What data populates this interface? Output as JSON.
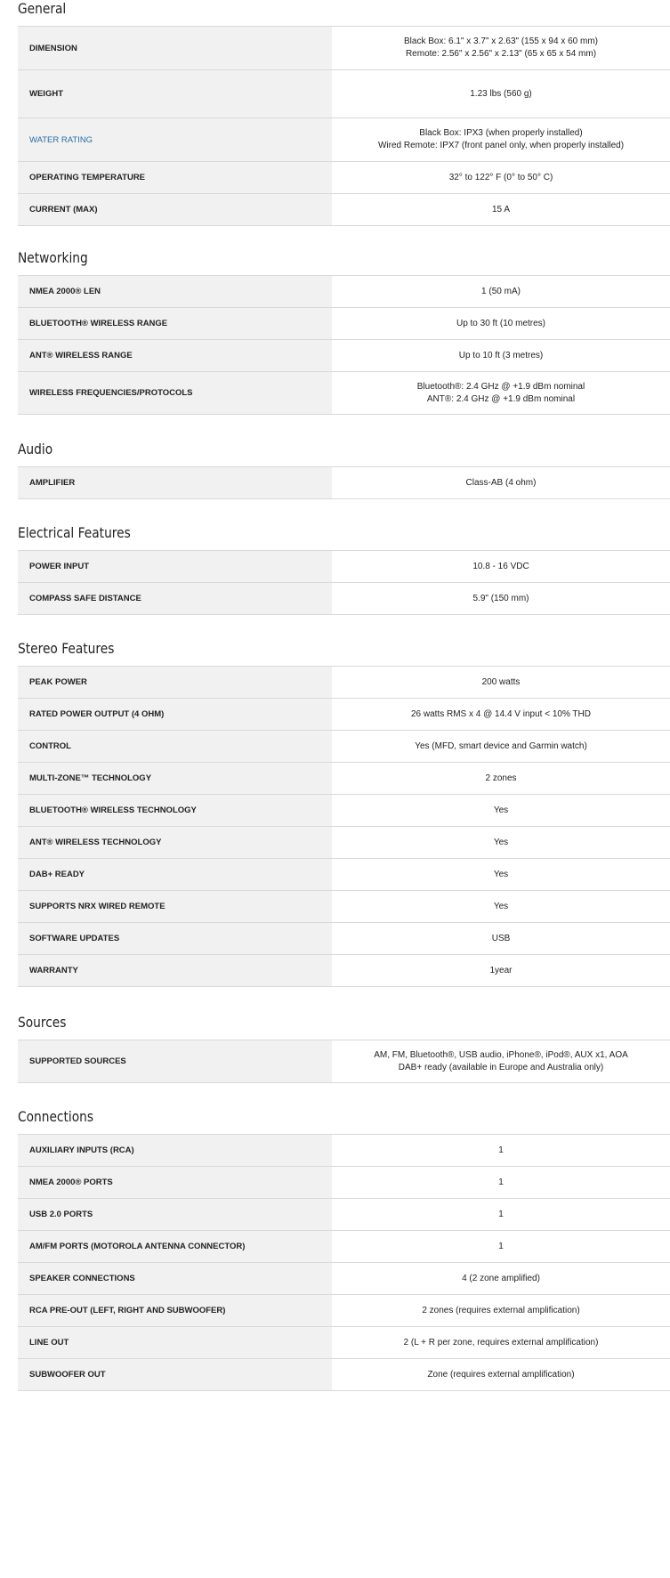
{
  "sections": [
    {
      "title": "General",
      "rows": [
        {
          "label": "DIMENSION",
          "values": [
            "Black Box: 6.1\" x 3.7\" x 2.63\" (155 x 94 x 60 mm)",
            "Remote: 2.56\" x 2.56\" x 2.13\" (65 x 65 x 54 mm)"
          ]
        },
        {
          "label": "WEIGHT",
          "values": [
            "1.23 lbs (560 g)"
          ]
        },
        {
          "label": "WATER RATING",
          "link": true,
          "values": [
            "Black Box: IPX3 (when properly installed)",
            "Wired Remote: IPX7 (front panel only, when properly installed)"
          ]
        },
        {
          "label": "OPERATING TEMPERATURE",
          "values": [
            "32° to 122° F (0° to 50° C)"
          ]
        },
        {
          "label": "CURRENT (MAX)",
          "values": [
            "15 A"
          ]
        }
      ]
    },
    {
      "title": "Networking",
      "rows": [
        {
          "label": "NMEA 2000® LEN",
          "values": [
            "1 (50 mA)"
          ]
        },
        {
          "label": "BLUETOOTH® WIRELESS RANGE",
          "values": [
            "Up to 30 ft (10 metres)"
          ]
        },
        {
          "label": "ANT® WIRELESS RANGE",
          "values": [
            "Up to 10 ft (3 metres)"
          ]
        },
        {
          "label": "WIRELESS FREQUENCIES/PROTOCOLS",
          "values": [
            "Bluetooth®: 2.4 GHz @ +1.9 dBm nominal",
            "ANT®: 2.4 GHz @ +1.9 dBm nominal"
          ]
        }
      ]
    },
    {
      "title": "Audio",
      "rows": [
        {
          "label": "AMPLIFIER",
          "values": [
            "Class-AB (4 ohm)"
          ]
        }
      ]
    },
    {
      "title": "Electrical Features",
      "rows": [
        {
          "label": "POWER INPUT",
          "values": [
            "10.8 - 16 VDC"
          ]
        },
        {
          "label": "COMPASS SAFE DISTANCE",
          "values": [
            "5.9\" (150 mm)"
          ]
        }
      ]
    },
    {
      "title": "Stereo Features",
      "rows": [
        {
          "label": "PEAK POWER",
          "values": [
            "200 watts"
          ]
        },
        {
          "label": "RATED POWER OUTPUT (4 OHM)",
          "values": [
            "26 watts RMS x 4 @ 14.4 V input < 10% THD"
          ]
        },
        {
          "label": "CONTROL",
          "values": [
            "Yes (MFD, smart device and Garmin watch)"
          ]
        },
        {
          "label": "MULTI-ZONE™ TECHNOLOGY",
          "values": [
            "2 zones"
          ]
        },
        {
          "label": "BLUETOOTH® WIRELESS TECHNOLOGY",
          "values": [
            "Yes"
          ]
        },
        {
          "label": "ANT® WIRELESS TECHNOLOGY",
          "values": [
            "Yes"
          ]
        },
        {
          "label": "DAB+ READY",
          "values": [
            "Yes"
          ]
        },
        {
          "label": "SUPPORTS NRX WIRED REMOTE",
          "values": [
            "Yes"
          ]
        },
        {
          "label": "SOFTWARE UPDATES",
          "values": [
            "USB"
          ]
        },
        {
          "label": "WARRANTY",
          "values": [
            "1year"
          ]
        }
      ]
    },
    {
      "title": "Sources",
      "rows": [
        {
          "label": "SUPPORTED SOURCES",
          "values": [
            "AM, FM, Bluetooth®, USB audio, iPhone®, iPod®, AUX x1, AOA",
            "DAB+ ready (available in Europe and Australia only)"
          ]
        }
      ]
    },
    {
      "title": "Connections",
      "rows": [
        {
          "label": "AUXILIARY INPUTS (RCA)",
          "values": [
            "1"
          ]
        },
        {
          "label": "NMEA 2000® PORTS",
          "values": [
            "1"
          ]
        },
        {
          "label": "USB 2.0 PORTS",
          "values": [
            "1"
          ]
        },
        {
          "label": "AM/FM PORTS (MOTOROLA ANTENNA CONNECTOR)",
          "values": [
            "1"
          ]
        },
        {
          "label": "SPEAKER CONNECTIONS",
          "values": [
            "4 (2 zone amplified)"
          ]
        },
        {
          "label": "RCA PRE-OUT (LEFT, RIGHT AND SUBWOOFER)",
          "values": [
            "2 zones (requires external amplification)"
          ]
        },
        {
          "label": "LINE OUT",
          "values": [
            "2 (L + R per zone, requires external amplification)"
          ]
        },
        {
          "label": "SUBWOOFER OUT",
          "values": [
            "Zone (requires external amplification)"
          ]
        }
      ]
    }
  ]
}
